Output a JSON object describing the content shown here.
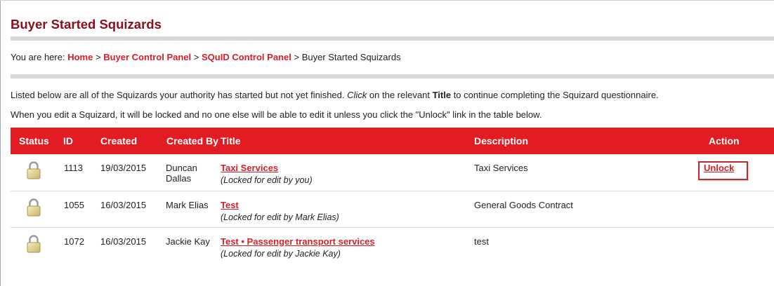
{
  "page": {
    "title": "Buyer Started Squizards"
  },
  "breadcrumb": {
    "prefix": "You are here:",
    "separator": ">",
    "home": "Home",
    "buyer_control_panel": "Buyer Control Panel",
    "squid_control_panel": "SQuID Control Panel",
    "current": "Buyer Started Squizards"
  },
  "intro": {
    "line1_a": "Listed below are all of the Squizards your authority has started but not yet finished.",
    "line1_click": "Click",
    "line1_b": "on the relevant",
    "line1_title": "Title",
    "line1_c": "to continue completing the Squizard questionnaire.",
    "line2": "When you edit a Squizard, it will be locked and no one else will be able to edit it unless you click the \"Unlock\" link in the table below."
  },
  "table": {
    "headers": {
      "status": "Status",
      "id": "ID",
      "created": "Created",
      "created_by": "Created By",
      "title": "Title",
      "description": "Description",
      "action": "Action"
    },
    "rows": [
      {
        "status_icon": "padlock-icon",
        "id": "1113",
        "created": "19/03/2015",
        "created_by_1": "Duncan",
        "created_by_2": "Dallas",
        "title": "Taxi Services",
        "lock_note": "(Locked for edit by you)",
        "description": "Taxi Services",
        "action": "Unlock"
      },
      {
        "status_icon": "padlock-icon",
        "id": "1055",
        "created": "16/03/2015",
        "created_by_1": "Mark Elias",
        "title": "Test",
        "lock_note": "(Locked for edit by Mark Elias)",
        "description": "General Goods Contract",
        "action": ""
      },
      {
        "status_icon": "padlock-icon",
        "id": "1072",
        "created": "16/03/2015",
        "created_by_1": "Jackie Kay",
        "title": "Test • Passenger transport services",
        "lock_note": "(Locked for edit by Jackie Kay)",
        "description": "test",
        "action": ""
      }
    ]
  },
  "colors": {
    "header_red": "#e31b23",
    "title_dark_red": "#8b0f1b",
    "link_red": "#d71f28"
  }
}
